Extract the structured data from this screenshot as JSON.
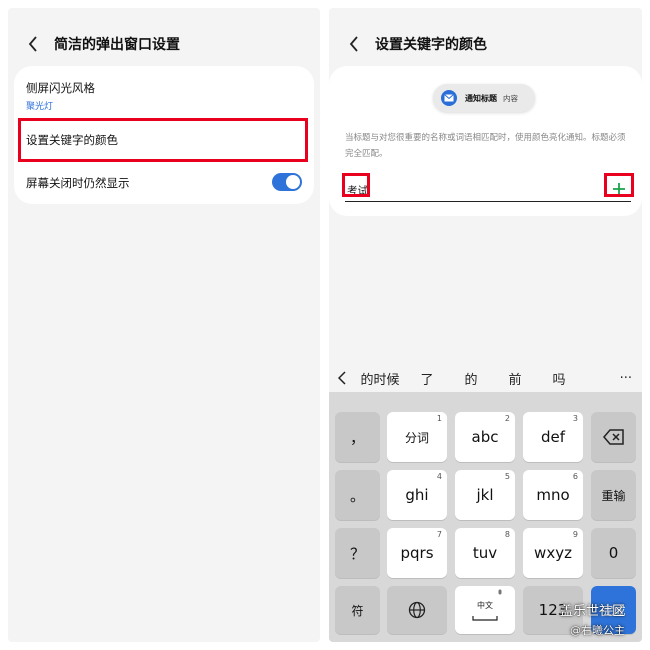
{
  "left": {
    "header": {
      "title": "简洁的弹出窗口设置"
    },
    "settings": [
      {
        "title": "侧屏闪光风格",
        "subtitle": "聚光灯"
      },
      {
        "title": "设置关键字的颜色"
      },
      {
        "title": "屏幕关闭时仍然显示",
        "toggle_on": true
      }
    ]
  },
  "right": {
    "header": {
      "title": "设置关键字的颜色"
    },
    "preview": {
      "title": "通知标题",
      "content": "内容"
    },
    "description": "当标题与对您很重要的名称或词语相匹配时，使用颜色亮化通知。标题必须完全匹配。",
    "keyword_input": {
      "value": "考试"
    },
    "suggestions": [
      "的时候",
      "了",
      "的",
      "前",
      "吗"
    ],
    "suggestion_more": "···",
    "keyboard": {
      "row1": [
        {
          "label": "，",
          "number": ""
        },
        {
          "label": "分词",
          "number": "1"
        },
        {
          "label": "abc",
          "number": "2"
        },
        {
          "label": "def",
          "number": "3"
        }
      ],
      "row2": [
        {
          "label": "。",
          "number": ""
        },
        {
          "label": "ghi",
          "number": "4"
        },
        {
          "label": "jkl",
          "number": "5"
        },
        {
          "label": "mno",
          "number": "6"
        },
        {
          "label": "重输",
          "number": ""
        }
      ],
      "row3": [
        {
          "label": "？",
          "number": ""
        },
        {
          "label": "pqrs",
          "number": "7"
        },
        {
          "label": "tuv",
          "number": "8"
        },
        {
          "label": "wxyz",
          "number": "9"
        },
        {
          "label": "0",
          "number": ""
        }
      ],
      "row4": {
        "symbols": "符",
        "space_label": "中文",
        "num_switch": "123",
        "done": "完成"
      }
    }
  },
  "colors": {
    "accent": "#2e73d9",
    "highlight": "#e8001e",
    "add": "#1aa34a"
  },
  "watermark": {
    "line1": "盖乐世社区",
    "line2": "@右曦公主"
  }
}
